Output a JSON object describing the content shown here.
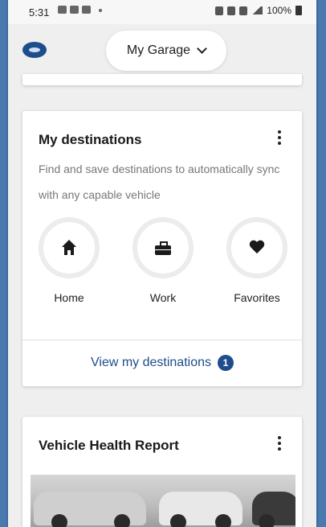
{
  "status_bar": {
    "time": "5:31",
    "battery": "100%"
  },
  "header": {
    "logo": "subaru-logo",
    "garage_label": "My Garage"
  },
  "destinations_card": {
    "title": "My destinations",
    "description": "Find and save destinations to automatically sync with any capable vehicle",
    "items": [
      {
        "label": "Home",
        "icon": "home-icon"
      },
      {
        "label": "Work",
        "icon": "briefcase-icon"
      },
      {
        "label": "Favorites",
        "icon": "heart-icon"
      }
    ],
    "view_link": "View my destinations",
    "badge": "1"
  },
  "health_card": {
    "title": "Vehicle Health Report"
  },
  "colors": {
    "accent": "#1e4d8c",
    "background": "#efefef",
    "frame": "#4a79ad"
  }
}
